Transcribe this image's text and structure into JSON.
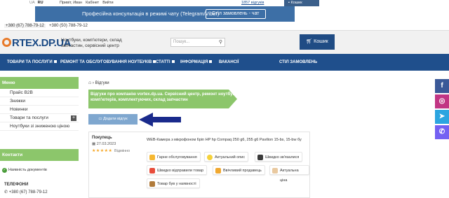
{
  "topbar": {
    "lang_ua": "UA",
    "lang_ru": "RU",
    "greeting": "Привіт, Иван",
    "cabinet": "Кабінет",
    "logout": "Вийти",
    "reviews_count": "1857 відгуків",
    "cart_mini": "Кошик"
  },
  "promo": {
    "text": "Професійна консультація в режимі чату (Telegram/Viber)",
    "chat_button": "Стіл замовлень - чат"
  },
  "phones": {
    "phone1": "+380 (67) 788-79-12",
    "phone2": "+380 (50) 788-79-12"
  },
  "header": {
    "logo": "RTEX.DP.UA",
    "tagline": "Ноутбуки, комп'ютери, склад запчастин, сервісний центр",
    "search_placeholder": "Пошук...",
    "cart_label": "Кошик"
  },
  "nav": {
    "items": [
      {
        "label": "ТОВАРИ ТА ПОСЛУГИ"
      },
      {
        "label": "РЕМОНТ ТА ОБСЛУГОВУВАННЯ НОУТБУКІВ"
      },
      {
        "label": "СТАТТІ"
      },
      {
        "label": "ІНФОРМАЦІЯ"
      },
      {
        "label": "ВАКАНСІЇ"
      },
      {
        "label": "СТІЛ ЗАМОВЛЕНЬ"
      }
    ]
  },
  "sidebar": {
    "menu_title": "Меню",
    "items": [
      {
        "label": "Прайс B2B"
      },
      {
        "label": "Знижки"
      },
      {
        "label": "Новинки"
      },
      {
        "label": "Товари та послуги"
      },
      {
        "label": "Ноутбуки зі зниженою ціною"
      }
    ],
    "contacts_title": "Контакти",
    "availability": "Наявність документів",
    "phones_title": "ТЕЛЕФОНИ",
    "phone": "+380 (67) 788-79-12"
  },
  "main": {
    "breadcrumb": "Відгуки",
    "banner_text": "Відгуки про компанію vortex.dp.ua. Сервісний центр, ремонт ноутбуків, комп'ютерів, комплектуючих, склад запчастин",
    "add_review_button": "Додати відгук",
    "review": {
      "author": "Покупець",
      "date": "27.03.2023",
      "stars": "★★★★★",
      "label": "Відмінно",
      "text": "WEB-Камера з мікрофоном 6pin HP hp Compaq 250 g6, 255 g6 Pavilion 15-bs, 15-bw бу",
      "tags": [
        {
          "label": "Гарне обслуговування",
          "icon": "thumbs-up-icon"
        },
        {
          "label": "Актуальний опис",
          "icon": "smile-icon"
        },
        {
          "label": "Швидко зв'язалися",
          "icon": "phone-icon"
        },
        {
          "label": "Швидко відправили товар",
          "icon": "rocket-icon"
        },
        {
          "label": "Ввічливий продавець",
          "icon": "handshake-icon"
        },
        {
          "label": "Актуальна ціна",
          "icon": "price-tag-icon"
        },
        {
          "label": "Товар був у наявності",
          "icon": "box-icon"
        }
      ]
    }
  },
  "colors": {
    "brand_blue": "#1f4f8c",
    "green": "#8cc66b",
    "orange": "#e87a2a"
  }
}
